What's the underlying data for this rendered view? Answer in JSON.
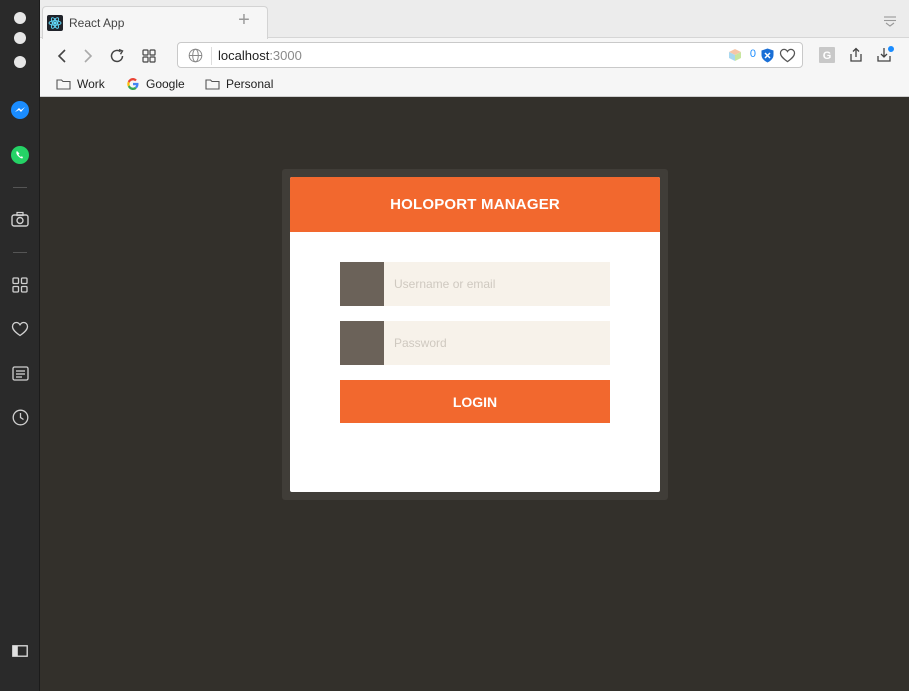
{
  "tab": {
    "title": "React App",
    "new_tab_symbol": "+"
  },
  "urlbar": {
    "host": "localhost",
    "port": ":3000",
    "extension_count": "0"
  },
  "bookmarks": [
    {
      "label": "Work",
      "icon": "folder-icon"
    },
    {
      "label": "Google",
      "icon": "google-icon"
    },
    {
      "label": "Personal",
      "icon": "folder-icon"
    }
  ],
  "login": {
    "title": "HOLOPORT MANAGER",
    "username_placeholder": "Username or email",
    "password_placeholder": "Password",
    "button_label": "LOGIN"
  },
  "colors": {
    "accent": "#f2682e",
    "page_bg": "#33302b",
    "input_bg": "#f7f2ea",
    "input_icon": "#6b6259"
  }
}
